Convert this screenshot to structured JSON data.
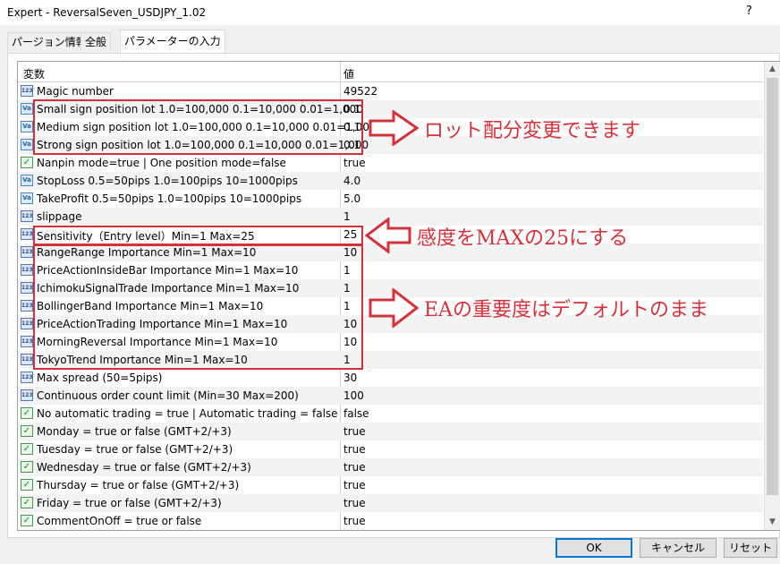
{
  "window": {
    "title": "Expert - ReversalSeven_USDJPY_1.02",
    "help_label": "?"
  },
  "tabs": [
    {
      "label": "パージョン情報"
    },
    {
      "label": "全般"
    },
    {
      "label": "パラメーターの入力"
    }
  ],
  "grid": {
    "headers": {
      "variable": "変数",
      "value": "値"
    },
    "rows": [
      {
        "icon": "123",
        "variable": "Magic number",
        "value": "49522"
      },
      {
        "icon": "Va",
        "variable": "Small sign position lot 1.0=100,000 0.1=10,000 0.01=1,000",
        "value": "0.1"
      },
      {
        "icon": "Va",
        "variable": "Medium sign position lot 1.0=100,000 0.1=10,000 0.01=1,000",
        "value": "0.1"
      },
      {
        "icon": "Va",
        "variable": "Strong sign position lot 1.0=100,000 0.1=10,000 0.01=1,000",
        "value": "0.1"
      },
      {
        "icon": "bool",
        "variable": "Nanpin mode=true | One position mode=false",
        "value": "true"
      },
      {
        "icon": "Va",
        "variable": "StopLoss 0.5=50pips    1.0=100pips    10=1000pips",
        "value": "4.0"
      },
      {
        "icon": "Va",
        "variable": "TakeProfit 0.5=50pips    1.0=100pips    10=1000pips",
        "value": "5.0"
      },
      {
        "icon": "123",
        "variable": "slippage",
        "value": "1"
      },
      {
        "icon": "123",
        "variable": "Sensitivity（Entry level）Min=1 Max=25",
        "value": "25"
      },
      {
        "icon": "123",
        "variable": "RangeRange Importance Min=1 Max=10",
        "value": "10"
      },
      {
        "icon": "123",
        "variable": "PriceActionInsideBar Importance Min=1 Max=10",
        "value": "1"
      },
      {
        "icon": "123",
        "variable": "IchimokuSignalTrade Importance Min=1 Max=10",
        "value": "1"
      },
      {
        "icon": "123",
        "variable": "BollingerBand Importance Min=1 Max=10",
        "value": "1"
      },
      {
        "icon": "123",
        "variable": "PriceActionTrading Importance Min=1 Max=10",
        "value": "10"
      },
      {
        "icon": "123",
        "variable": "MorningReversal Importance Min=1 Max=10",
        "value": "10"
      },
      {
        "icon": "123",
        "variable": "TokyoTrend Importance Min=1 Max=10",
        "value": "1"
      },
      {
        "icon": "123",
        "variable": "Max spread (50=5pips)",
        "value": "30"
      },
      {
        "icon": "123",
        "variable": "Continuous order count limit (Min=30    Max=200)",
        "value": "100"
      },
      {
        "icon": "bool",
        "variable": "No automatic trading = true | Automatic trading = false",
        "value": "false"
      },
      {
        "icon": "bool",
        "variable": "Monday = true or false    (GMT+2/+3)",
        "value": "true"
      },
      {
        "icon": "bool",
        "variable": "Tuesday = true or false    (GMT+2/+3)",
        "value": "true"
      },
      {
        "icon": "bool",
        "variable": "Wednesday = true or false    (GMT+2/+3)",
        "value": "true"
      },
      {
        "icon": "bool",
        "variable": "Thursday = true or false    (GMT+2/+3)",
        "value": "true"
      },
      {
        "icon": "bool",
        "variable": "Friday = true or false    (GMT+2/+3)",
        "value": "true"
      },
      {
        "icon": "bool",
        "variable": "CommentOnOff = true or false",
        "value": "true"
      }
    ]
  },
  "annotations": {
    "lot": "ロット配分変更できます",
    "sensitivity": "感度をMAXの25にする",
    "importance": "EAの重要度はデフォルトのまま",
    "color": "#d5313a"
  },
  "buttons": {
    "ok": "OK",
    "cancel": "キャンセル",
    "reset": "リセット"
  }
}
